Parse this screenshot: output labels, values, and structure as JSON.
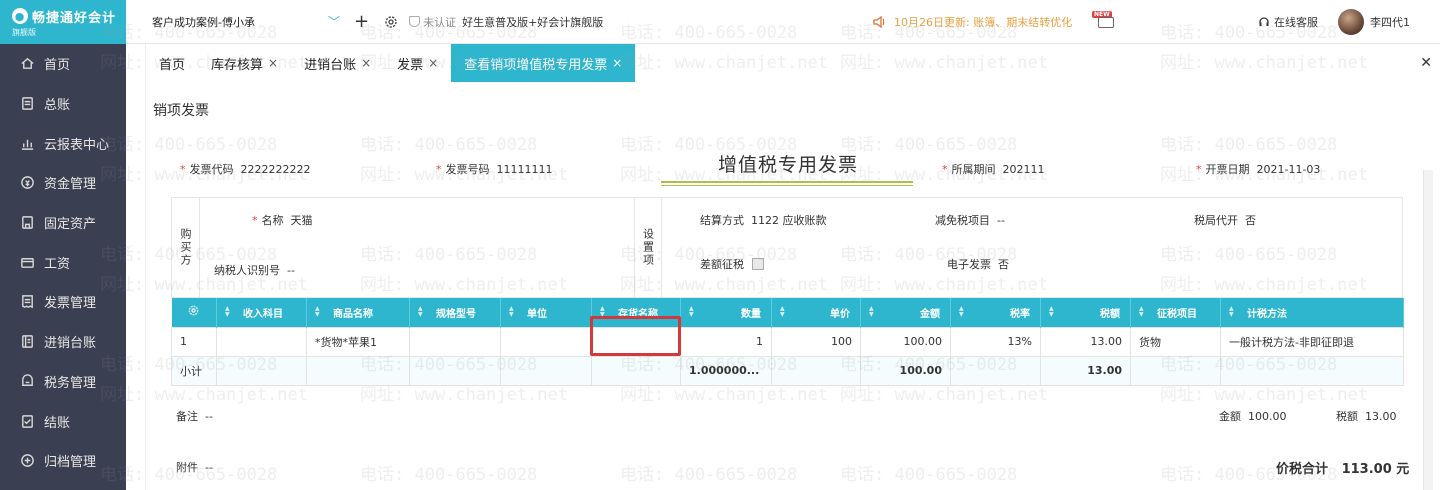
{
  "sidebar": {
    "logo": "畅捷通好会计",
    "logo_sub": "旗舰版",
    "items": [
      {
        "label": "首页",
        "icon": "home-icon"
      },
      {
        "label": "总账",
        "icon": "ledger-icon"
      },
      {
        "label": "云报表中心",
        "icon": "chart-icon"
      },
      {
        "label": "资金管理",
        "icon": "money-icon"
      },
      {
        "label": "固定资产",
        "icon": "asset-icon"
      },
      {
        "label": "工资",
        "icon": "salary-icon"
      },
      {
        "label": "发票管理",
        "icon": "invoice-icon"
      },
      {
        "label": "进销台账",
        "icon": "ledger-book-icon"
      },
      {
        "label": "税务管理",
        "icon": "tax-icon"
      },
      {
        "label": "结账",
        "icon": "checkout-icon"
      },
      {
        "label": "归档管理",
        "icon": "archive-icon"
      }
    ]
  },
  "topbar": {
    "company": "客户成功案例-傅小承",
    "cert": "未认证",
    "edition": "好生意普及版+好会计旗舰版",
    "notice": "10月26日更新: 账簿、期末结转优化",
    "service": "在线客服",
    "user": "李四代1"
  },
  "tabs": [
    {
      "label": "首页",
      "closable": false
    },
    {
      "label": "库存核算",
      "closable": true
    },
    {
      "label": "进销台账",
      "closable": true
    },
    {
      "label": "发票",
      "closable": true
    },
    {
      "label": "查看销项增值税专用发票",
      "closable": true,
      "active": true
    }
  ],
  "page": {
    "title": "销项发票",
    "invoice_title": "增值税专用发票",
    "invoice_code_label": "发票代码",
    "invoice_code": "2222222222",
    "invoice_no_label": "发票号码",
    "invoice_no": "11111111",
    "period_label": "所属期间",
    "period": "202111",
    "date_label": "开票日期",
    "date": "2021-11-03"
  },
  "buyer": {
    "side_label": "购买方",
    "name_label": "名称",
    "name": "天猫",
    "taxid_label": "纳税人识别号",
    "taxid": "--"
  },
  "settings": {
    "side_label": "设置项",
    "settle_label": "结算方式",
    "settle": "1122 应收账款",
    "exempt_label": "减免税项目",
    "exempt": "--",
    "agent_label": "税局代开",
    "agent": "否",
    "diff_label": "差额征税",
    "einvoice_label": "电子发票",
    "einvoice": "否"
  },
  "table": {
    "headers": [
      "收入科目",
      "商品名称",
      "规格型号",
      "单位",
      "存货名称",
      "数量",
      "单价",
      "金额",
      "税率",
      "税额",
      "征税项目",
      "计税方法"
    ],
    "rows": [
      [
        "1",
        "",
        "*货物*苹果1",
        "",
        "",
        "",
        "1",
        "100",
        "100.00",
        "13%",
        "13.00",
        "货物",
        "一般计税方法-非即征即退"
      ]
    ],
    "subtotal": [
      "小计",
      "",
      "",
      "",
      "",
      "",
      "1.000000...",
      "",
      "100.00",
      "",
      "13.00",
      "",
      ""
    ]
  },
  "footer": {
    "remark_label": "备注",
    "remark": "--",
    "attach_label": "附件",
    "attach": "--",
    "amount_label": "金额",
    "amount": "100.00",
    "tax_label": "税额",
    "tax": "13.00",
    "total_label": "价税合计",
    "total": "113.00 元"
  },
  "watermark": {
    "phone": "电话: 400-665-0028",
    "site": "网址: www.chanjet.net"
  },
  "colors": {
    "accent": "#2fb6cf",
    "sidebar": "#3a3f51",
    "highlight": "#d03a3a"
  }
}
